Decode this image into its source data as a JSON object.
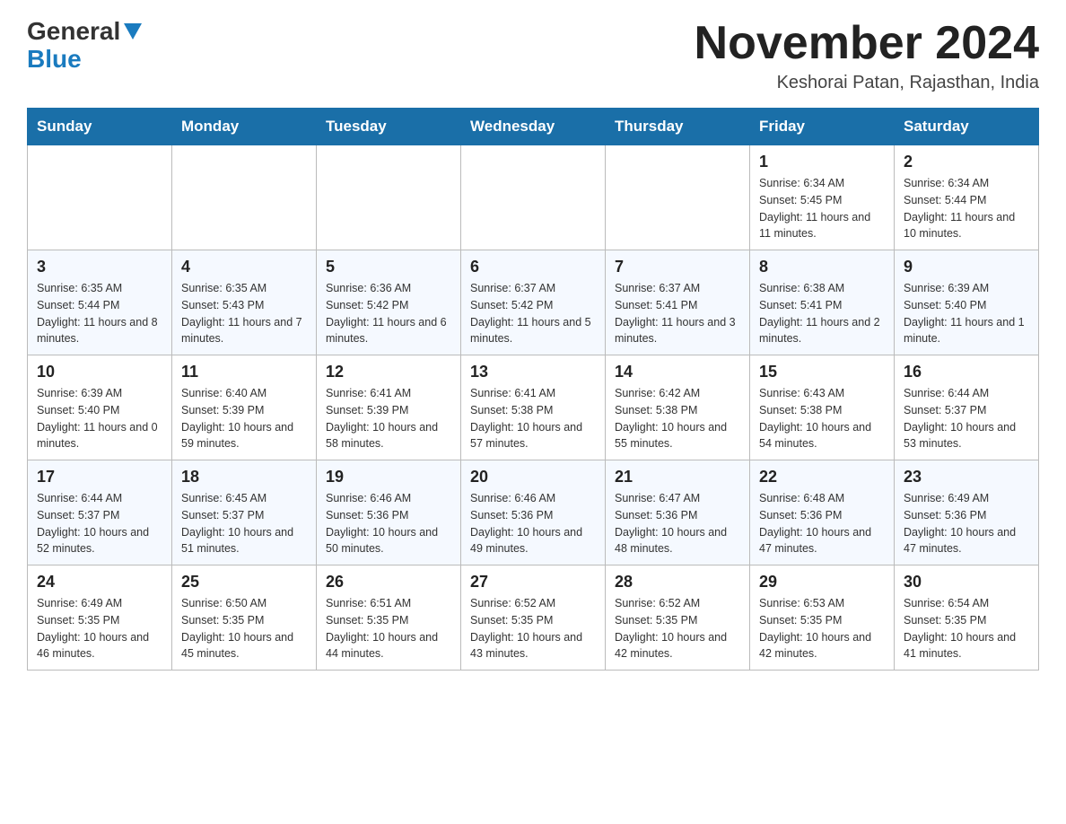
{
  "header": {
    "logo_general": "General",
    "logo_blue": "Blue",
    "month_title": "November 2024",
    "location": "Keshorai Patan, Rajasthan, India"
  },
  "weekdays": [
    "Sunday",
    "Monday",
    "Tuesday",
    "Wednesday",
    "Thursday",
    "Friday",
    "Saturday"
  ],
  "weeks": [
    [
      {
        "day": "",
        "info": ""
      },
      {
        "day": "",
        "info": ""
      },
      {
        "day": "",
        "info": ""
      },
      {
        "day": "",
        "info": ""
      },
      {
        "day": "",
        "info": ""
      },
      {
        "day": "1",
        "info": "Sunrise: 6:34 AM\nSunset: 5:45 PM\nDaylight: 11 hours and 11 minutes."
      },
      {
        "day": "2",
        "info": "Sunrise: 6:34 AM\nSunset: 5:44 PM\nDaylight: 11 hours and 10 minutes."
      }
    ],
    [
      {
        "day": "3",
        "info": "Sunrise: 6:35 AM\nSunset: 5:44 PM\nDaylight: 11 hours and 8 minutes."
      },
      {
        "day": "4",
        "info": "Sunrise: 6:35 AM\nSunset: 5:43 PM\nDaylight: 11 hours and 7 minutes."
      },
      {
        "day": "5",
        "info": "Sunrise: 6:36 AM\nSunset: 5:42 PM\nDaylight: 11 hours and 6 minutes."
      },
      {
        "day": "6",
        "info": "Sunrise: 6:37 AM\nSunset: 5:42 PM\nDaylight: 11 hours and 5 minutes."
      },
      {
        "day": "7",
        "info": "Sunrise: 6:37 AM\nSunset: 5:41 PM\nDaylight: 11 hours and 3 minutes."
      },
      {
        "day": "8",
        "info": "Sunrise: 6:38 AM\nSunset: 5:41 PM\nDaylight: 11 hours and 2 minutes."
      },
      {
        "day": "9",
        "info": "Sunrise: 6:39 AM\nSunset: 5:40 PM\nDaylight: 11 hours and 1 minute."
      }
    ],
    [
      {
        "day": "10",
        "info": "Sunrise: 6:39 AM\nSunset: 5:40 PM\nDaylight: 11 hours and 0 minutes."
      },
      {
        "day": "11",
        "info": "Sunrise: 6:40 AM\nSunset: 5:39 PM\nDaylight: 10 hours and 59 minutes."
      },
      {
        "day": "12",
        "info": "Sunrise: 6:41 AM\nSunset: 5:39 PM\nDaylight: 10 hours and 58 minutes."
      },
      {
        "day": "13",
        "info": "Sunrise: 6:41 AM\nSunset: 5:38 PM\nDaylight: 10 hours and 57 minutes."
      },
      {
        "day": "14",
        "info": "Sunrise: 6:42 AM\nSunset: 5:38 PM\nDaylight: 10 hours and 55 minutes."
      },
      {
        "day": "15",
        "info": "Sunrise: 6:43 AM\nSunset: 5:38 PM\nDaylight: 10 hours and 54 minutes."
      },
      {
        "day": "16",
        "info": "Sunrise: 6:44 AM\nSunset: 5:37 PM\nDaylight: 10 hours and 53 minutes."
      }
    ],
    [
      {
        "day": "17",
        "info": "Sunrise: 6:44 AM\nSunset: 5:37 PM\nDaylight: 10 hours and 52 minutes."
      },
      {
        "day": "18",
        "info": "Sunrise: 6:45 AM\nSunset: 5:37 PM\nDaylight: 10 hours and 51 minutes."
      },
      {
        "day": "19",
        "info": "Sunrise: 6:46 AM\nSunset: 5:36 PM\nDaylight: 10 hours and 50 minutes."
      },
      {
        "day": "20",
        "info": "Sunrise: 6:46 AM\nSunset: 5:36 PM\nDaylight: 10 hours and 49 minutes."
      },
      {
        "day": "21",
        "info": "Sunrise: 6:47 AM\nSunset: 5:36 PM\nDaylight: 10 hours and 48 minutes."
      },
      {
        "day": "22",
        "info": "Sunrise: 6:48 AM\nSunset: 5:36 PM\nDaylight: 10 hours and 47 minutes."
      },
      {
        "day": "23",
        "info": "Sunrise: 6:49 AM\nSunset: 5:36 PM\nDaylight: 10 hours and 47 minutes."
      }
    ],
    [
      {
        "day": "24",
        "info": "Sunrise: 6:49 AM\nSunset: 5:35 PM\nDaylight: 10 hours and 46 minutes."
      },
      {
        "day": "25",
        "info": "Sunrise: 6:50 AM\nSunset: 5:35 PM\nDaylight: 10 hours and 45 minutes."
      },
      {
        "day": "26",
        "info": "Sunrise: 6:51 AM\nSunset: 5:35 PM\nDaylight: 10 hours and 44 minutes."
      },
      {
        "day": "27",
        "info": "Sunrise: 6:52 AM\nSunset: 5:35 PM\nDaylight: 10 hours and 43 minutes."
      },
      {
        "day": "28",
        "info": "Sunrise: 6:52 AM\nSunset: 5:35 PM\nDaylight: 10 hours and 42 minutes."
      },
      {
        "day": "29",
        "info": "Sunrise: 6:53 AM\nSunset: 5:35 PM\nDaylight: 10 hours and 42 minutes."
      },
      {
        "day": "30",
        "info": "Sunrise: 6:54 AM\nSunset: 5:35 PM\nDaylight: 10 hours and 41 minutes."
      }
    ]
  ]
}
